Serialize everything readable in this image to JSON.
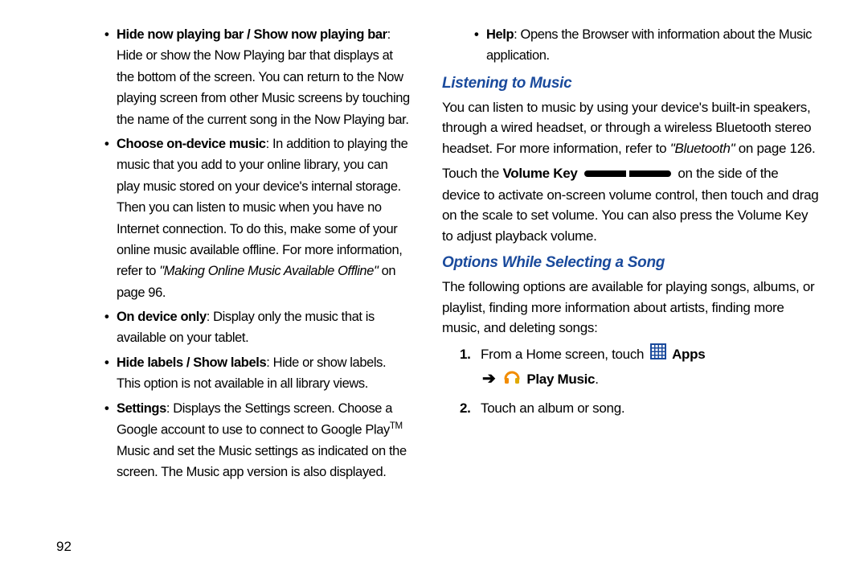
{
  "left_col": {
    "items": [
      {
        "bold": "Hide now playing bar / Show now playing bar",
        "rest": ": Hide or show the Now Playing bar that displays at the bottom of the screen. You can return to the Now playing screen from other Music screens by touching the name of the current song in the Now Playing bar."
      },
      {
        "bold": "Choose on-device music",
        "rest_part1": ": In addition to playing the music that you add to your online library, you can play music stored on your device's internal storage. Then you can listen to music when you have no Internet connection. To do this, make some of your online music available offline. For more information, refer to ",
        "italic_ref": "\"Making Online Music Available Offline\"",
        "rest_part2": "  on page 96."
      },
      {
        "bold": "On device only",
        "rest": ": Display only the music that is available on your tablet."
      },
      {
        "bold": "Hide labels / Show labels",
        "rest": ": Hide or show labels. This option is not available in all library views."
      },
      {
        "bold": "Settings",
        "rest_part1": ": Displays the Settings screen. Choose a Google account to use to connect to Google Play",
        "tm": "TM",
        "rest_part2": " Music and set the Music settings as indicated on the screen. The Music app version is also displayed."
      }
    ]
  },
  "right_col": {
    "help_item": {
      "bold": "Help",
      "rest": ": Opens the Browser with information about the Music application."
    },
    "heading1": "Listening to Music",
    "para1_part1": "You can listen to music by using your device's built-in speakers, through a wired headset, or through a wireless Bluetooth stereo headset. For more information, refer to ",
    "para1_italic": "\"Bluetooth\" ",
    "para1_part2": " on page 126.",
    "para2_part1": "Touch the ",
    "para2_bold": "Volume Key",
    "para2_part2": " on the side of the device to activate on-screen volume control, then touch and drag on the scale to set volume. You can also press the Volume Key to adjust playback volume.",
    "heading2": "Options While Selecting a Song",
    "para3": "The following options are available for playing songs, albums, or playlist, finding more information about artists, finding more music, and deleting songs:",
    "steps": {
      "s1_part1": "From a Home screen, touch ",
      "s1_apps": "Apps",
      "s1_arrow": "➔",
      "s1_playmusic": "Play Music",
      "s1_end": ".",
      "s2": "Touch an album or song."
    }
  },
  "page_number": "92"
}
